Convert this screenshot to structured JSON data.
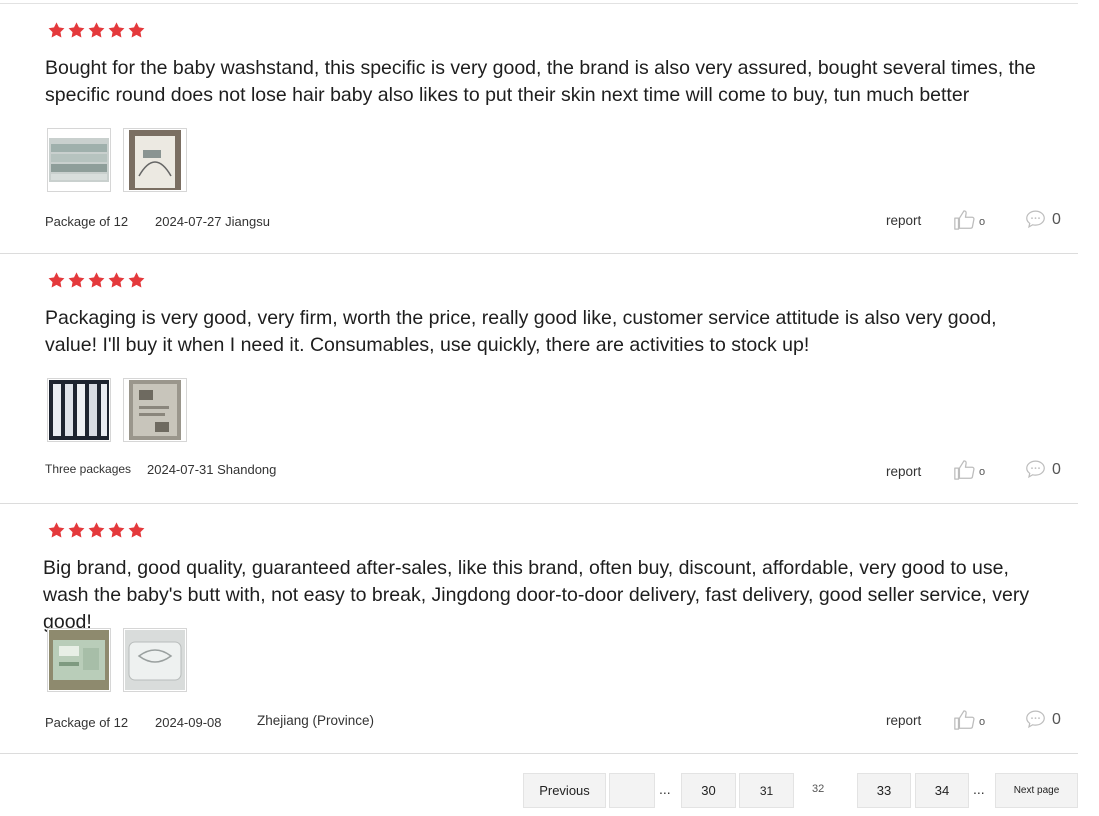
{
  "reviews": [
    {
      "rating": 5,
      "text": "Bought for the baby washstand, this specific is very good, the brand is also very assured, bought several times, the specific round does not lose hair baby also likes to put their skin next time will come to buy, tun much better",
      "variant": "Package of 12",
      "date": "2024-07-27 Jiangsu",
      "location": "",
      "report_label": "report",
      "likes": "o",
      "comments": "0"
    },
    {
      "rating": 5,
      "text": "Packaging is very good, very firm, worth the price, really good like, customer service attitude is also very good, value! I'll buy it when I need it. Consumables, use quickly, there are activities to stock up!",
      "variant": "Three packages",
      "date": "2024-07-31 Shandong",
      "location": "",
      "report_label": "report",
      "likes": "o",
      "comments": "0"
    },
    {
      "rating": 5,
      "text": "Big brand, good quality, guaranteed after-sales, like this brand, often buy, discount, affordable, very good to use, wash the baby's butt with, not easy to break, Jingdong door-to-door delivery, fast delivery, good seller service, very good!",
      "variant": "Package of 12",
      "date": "2024-09-08",
      "location": "Zhejiang (Province)",
      "report_label": "report",
      "likes": "o",
      "comments": "0"
    }
  ],
  "pagination": {
    "previous": "Previous",
    "ellipsis": "...",
    "pages": [
      "30",
      "31",
      "32",
      "33",
      "34"
    ],
    "current": "32",
    "next": "Next page"
  },
  "colors": {
    "star": "#e4393c",
    "divider": "#dcdcdc",
    "button_bg": "#f3f3f3"
  },
  "icons": [
    "star-icon",
    "thumbs-up-icon",
    "comment-bubble-icon"
  ]
}
